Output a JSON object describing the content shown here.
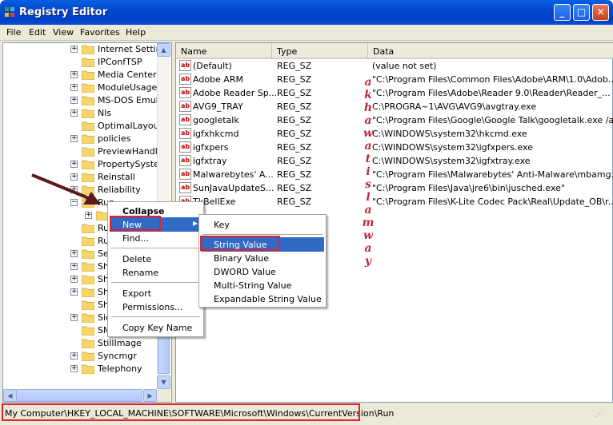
{
  "window": {
    "title": "Registry Editor"
  },
  "menubar": [
    "File",
    "Edit",
    "View",
    "Favorites",
    "Help"
  ],
  "tree": [
    {
      "label": "Internet Settin",
      "exp": "+"
    },
    {
      "label": "IPConfTSP",
      "exp": ""
    },
    {
      "label": "Media Center",
      "exp": "+"
    },
    {
      "label": "ModuleUsage",
      "exp": "+"
    },
    {
      "label": "MS-DOS Emulat",
      "exp": "+"
    },
    {
      "label": "Nls",
      "exp": "+"
    },
    {
      "label": "OptimalLayout",
      "exp": ""
    },
    {
      "label": "policies",
      "exp": "+"
    },
    {
      "label": "PreviewHandle",
      "exp": ""
    },
    {
      "label": "PropertySyster",
      "exp": "+"
    },
    {
      "label": "Reinstall",
      "exp": "+"
    },
    {
      "label": "Reliability",
      "exp": "+"
    },
    {
      "label": "Run",
      "exp": "−"
    },
    {
      "label": "",
      "exp": "+"
    },
    {
      "label": "Ru",
      "exp": ""
    },
    {
      "label": "Ru",
      "exp": ""
    },
    {
      "label": "Se",
      "exp": "+"
    },
    {
      "label": "Sh",
      "exp": "+"
    },
    {
      "label": "Sh",
      "exp": "+"
    },
    {
      "label": "Sh",
      "exp": "+"
    },
    {
      "label": "Sh",
      "exp": ""
    },
    {
      "label": "Sic",
      "exp": "+"
    },
    {
      "label": "SMDEn",
      "exp": ""
    },
    {
      "label": "StillImage",
      "exp": ""
    },
    {
      "label": "Syncmgr",
      "exp": "+"
    },
    {
      "label": "Telephony",
      "exp": "+"
    }
  ],
  "columns": {
    "name": "Name",
    "type": "Type",
    "data": "Data"
  },
  "values": [
    {
      "name": "(Default)",
      "type": "REG_SZ",
      "data": "(value not set)"
    },
    {
      "name": "Adobe ARM",
      "type": "REG_SZ",
      "data": "\"C:\\Program Files\\Common Files\\Adobe\\ARM\\1.0\\Adob..."
    },
    {
      "name": "Adobe Reader Sp...",
      "type": "REG_SZ",
      "data": "\"C:\\Program Files\\Adobe\\Reader 9.0\\Reader\\Reader_..."
    },
    {
      "name": "AVG9_TRAY",
      "type": "REG_SZ",
      "data": "C:\\PROGRA~1\\AVG\\AVG9\\avgtray.exe"
    },
    {
      "name": "googletalk",
      "type": "REG_SZ",
      "data": "\"C:\\Program Files\\Google\\Google Talk\\googletalk.exe /a..."
    },
    {
      "name": "igfxhkcmd",
      "type": "REG_SZ",
      "data": "C:\\WINDOWS\\system32\\hkcmd.exe"
    },
    {
      "name": "igfxpers",
      "type": "REG_SZ",
      "data": "C:\\WINDOWS\\system32\\igfxpers.exe"
    },
    {
      "name": "igfxtray",
      "type": "REG_SZ",
      "data": "C:\\WINDOWS\\system32\\igfxtray.exe"
    },
    {
      "name": "Malwarebytes' A...",
      "type": "REG_SZ",
      "data": "\"C:\\Program Files\\Malwarebytes' Anti-Malware\\mbamg..."
    },
    {
      "name": "SunJavaUpdateS...",
      "type": "REG_SZ",
      "data": "\"C:\\Program Files\\Java\\jre6\\bin\\jusched.exe\""
    },
    {
      "name": "TkBellExe",
      "type": "REG_SZ",
      "data": "\"C:\\Program Files\\K-Lite Codec Pack\\Real\\Update_OB\\r..."
    }
  ],
  "context_menu": [
    "Collapse",
    "New",
    "Find...",
    "Delete",
    "Rename",
    "Export",
    "Permissions...",
    "Copy Key Name"
  ],
  "new_submenu": [
    "Key",
    "String Value",
    "Binary Value",
    "DWORD Value",
    "Multi-String Value",
    "Expandable String Value"
  ],
  "status": "My Computer\\HKEY_LOCAL_MACHINE\\SOFTWARE\\Microsoft\\Windows\\CurrentVersion\\Run",
  "watermark": [
    "a",
    "k",
    "h",
    "a",
    "w",
    "a",
    "t",
    "i",
    "s",
    "l",
    "a",
    "m",
    "w",
    "a",
    "y"
  ],
  "colors": {
    "title_bar": "#0148d0",
    "menu_highlight": "#316ac5",
    "callout_red": "#e0202c",
    "arrow": "#5a1a1a"
  }
}
